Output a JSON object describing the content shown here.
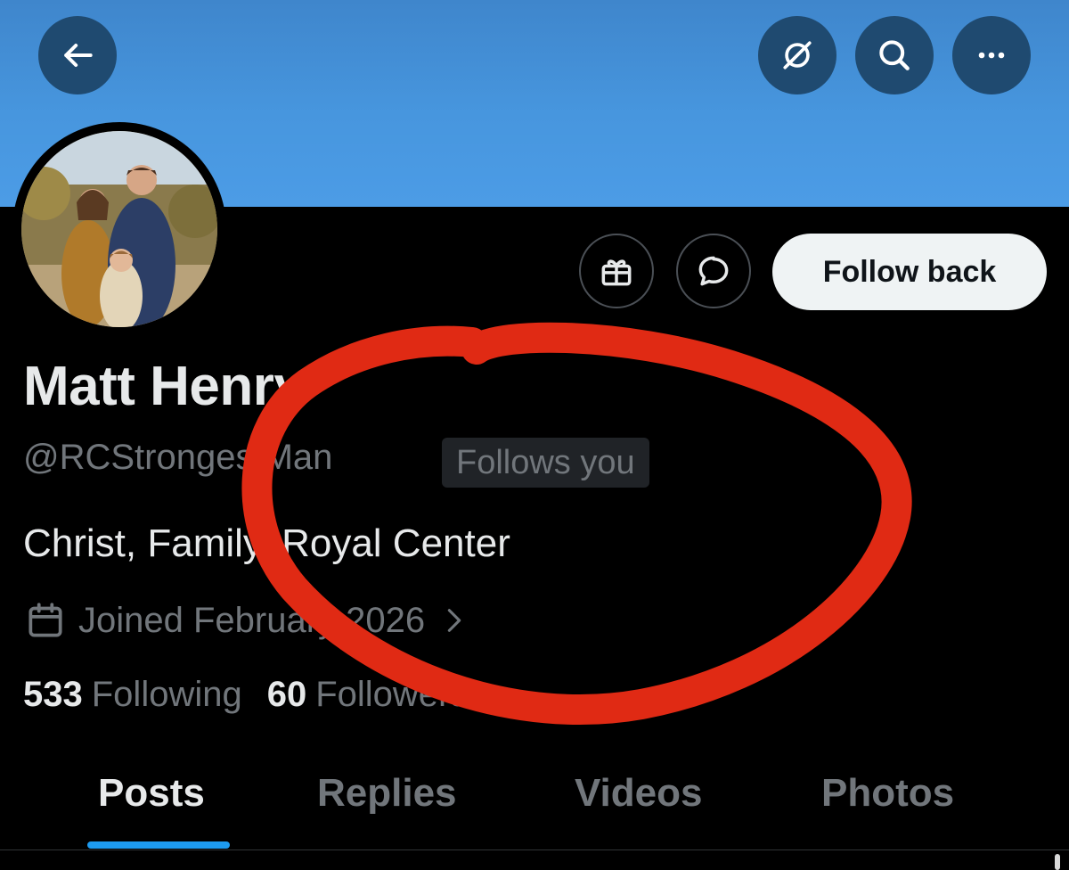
{
  "header": {
    "back_icon": "arrow-left-icon",
    "grok_icon": "grok-icon",
    "search_icon": "search-icon",
    "more_icon": "more-horizontal-icon",
    "banner_color": "#4796de",
    "button_color": "#1f4a70"
  },
  "profile": {
    "display_name": "Matt Henry",
    "handle": "@RCStrongestMan",
    "follows_you_badge": "Follows you",
    "bio": "Christ, Family, Royal Center",
    "joined": "Joined February 2026",
    "following_count": "533",
    "following_label": "Following",
    "followers_count": "60",
    "followers_label": "Followers"
  },
  "actions": {
    "gift_icon": "gift-icon",
    "message_icon": "message-icon",
    "follow_back_label": "Follow back"
  },
  "tabs": [
    {
      "label": "Posts",
      "active": true
    },
    {
      "label": "Replies",
      "active": false
    },
    {
      "label": "Videos",
      "active": false
    },
    {
      "label": "Photos",
      "active": false
    }
  ],
  "colors": {
    "accent": "#1d9bf0",
    "text_primary": "#e7e9ea",
    "text_secondary": "#71767b",
    "annotation_red": "#e02a14"
  }
}
